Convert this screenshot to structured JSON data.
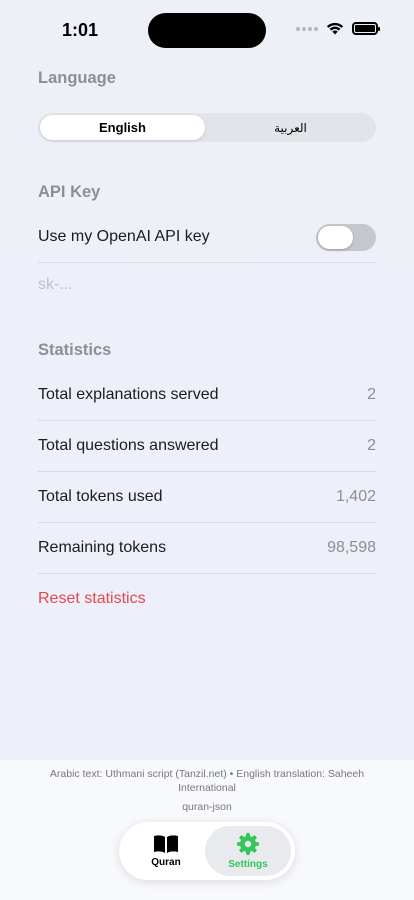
{
  "status_bar": {
    "time": "1:01"
  },
  "sections": {
    "language": "Language",
    "api_key": "API Key",
    "statistics": "Statistics"
  },
  "language": {
    "options": [
      "English",
      "العربية"
    ],
    "selected": "English"
  },
  "api": {
    "toggle_label": "Use my OpenAI API key",
    "toggle_on": false,
    "placeholder": "sk-..."
  },
  "stats": [
    {
      "label": "Total explanations served",
      "value": "2"
    },
    {
      "label": "Total questions answered",
      "value": "2"
    },
    {
      "label": "Total tokens used",
      "value": "1,402"
    },
    {
      "label": "Remaining tokens",
      "value": "98,598"
    }
  ],
  "reset_label": "Reset statistics",
  "footer": {
    "attribution": "Arabic text: Uthmani script (Tanzil.net) • English translation: Saheeh International",
    "package": "quran-json"
  },
  "tabs": [
    {
      "label": "Quran",
      "icon": "book-icon"
    },
    {
      "label": "Settings",
      "icon": "gear-icon",
      "active": true
    }
  ],
  "colors": {
    "accent_green": "#34c759",
    "destructive_red": "#e5484d",
    "secondary_text": "#8e8e93"
  }
}
